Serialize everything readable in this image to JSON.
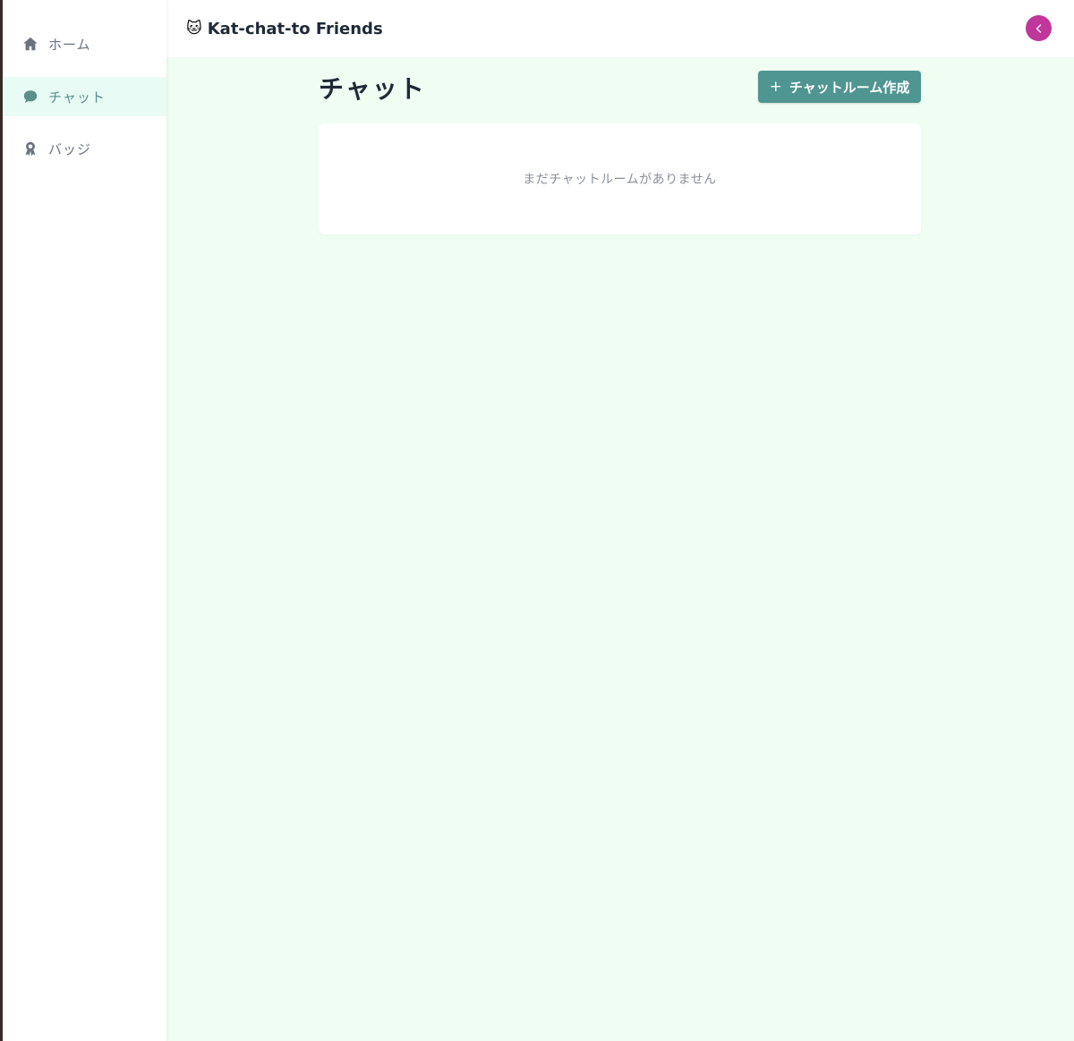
{
  "header": {
    "app_emoji": "🐱",
    "app_title": "Kat-chat-to Friends",
    "collapse_icon": "chevron-left-icon"
  },
  "sidebar": {
    "items": [
      {
        "label": "ホーム",
        "icon": "home-icon",
        "active": false
      },
      {
        "label": "チャット",
        "icon": "chat-bubble-icon",
        "active": true
      },
      {
        "label": "バッジ",
        "icon": "badge-icon",
        "active": false
      }
    ]
  },
  "main": {
    "title": "チャット",
    "create_button": {
      "icon": "plus-icon",
      "plus": "+",
      "label": "チャットルーム作成"
    },
    "empty_message": "まだチャットルームがありません"
  },
  "colors": {
    "accent": "#4f9591",
    "active_bg": "#e8fbf4",
    "page_bg": "#effdf3",
    "collapse_button": "#c0369a"
  }
}
